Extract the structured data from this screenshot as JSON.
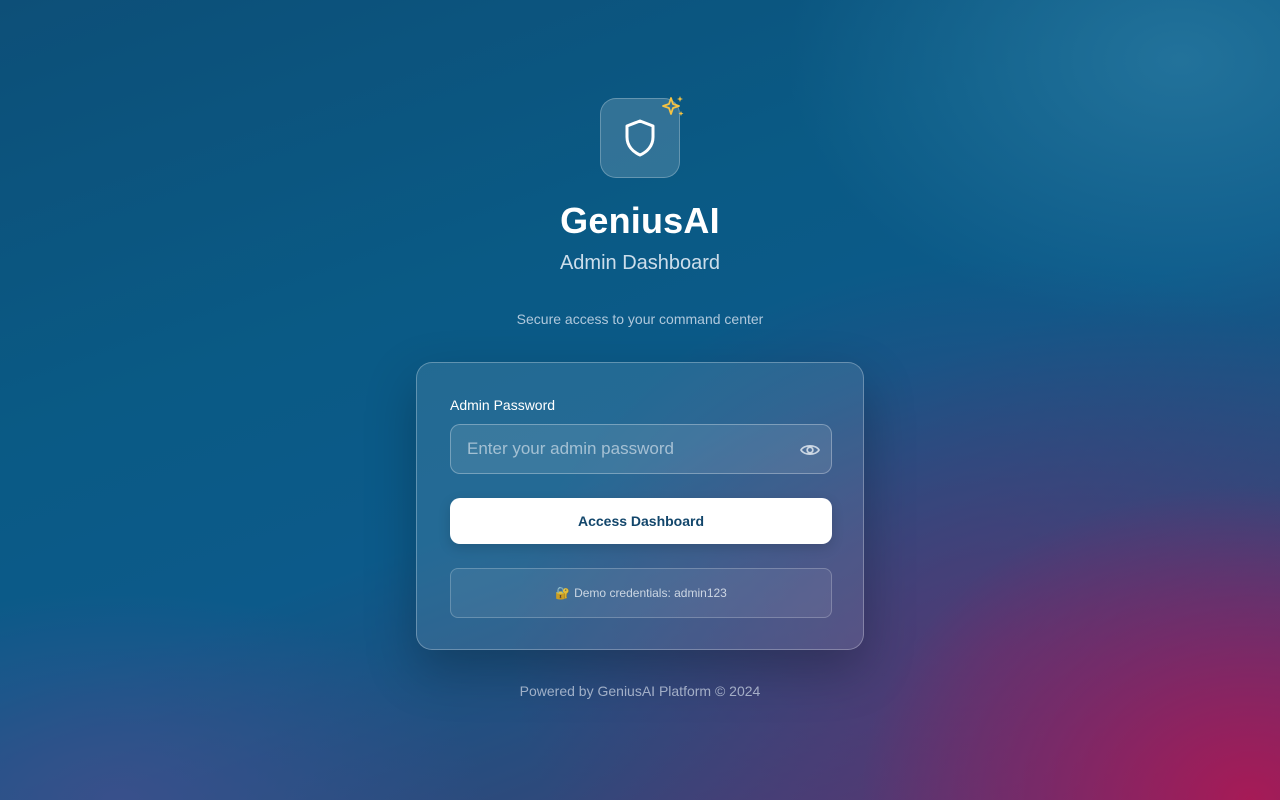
{
  "brand": {
    "title": "GeniusAI",
    "subtitle": "Admin Dashboard",
    "tagline": "Secure access to your command center",
    "logo_icon": "shield-icon",
    "badge_icon": "sparkles-icon"
  },
  "login_form": {
    "password_label": "Admin Password",
    "password_placeholder": "Enter your admin password",
    "password_value": "",
    "toggle_icon": "eye-icon",
    "submit_label": "Access Dashboard",
    "demo_icon": "🔐",
    "demo_text": "Demo credentials: admin123"
  },
  "footer": {
    "text": "Powered by GeniusAI Platform © 2024"
  },
  "colors": {
    "accent_button_text": "#12466b",
    "sparkle": "#f5c342"
  }
}
